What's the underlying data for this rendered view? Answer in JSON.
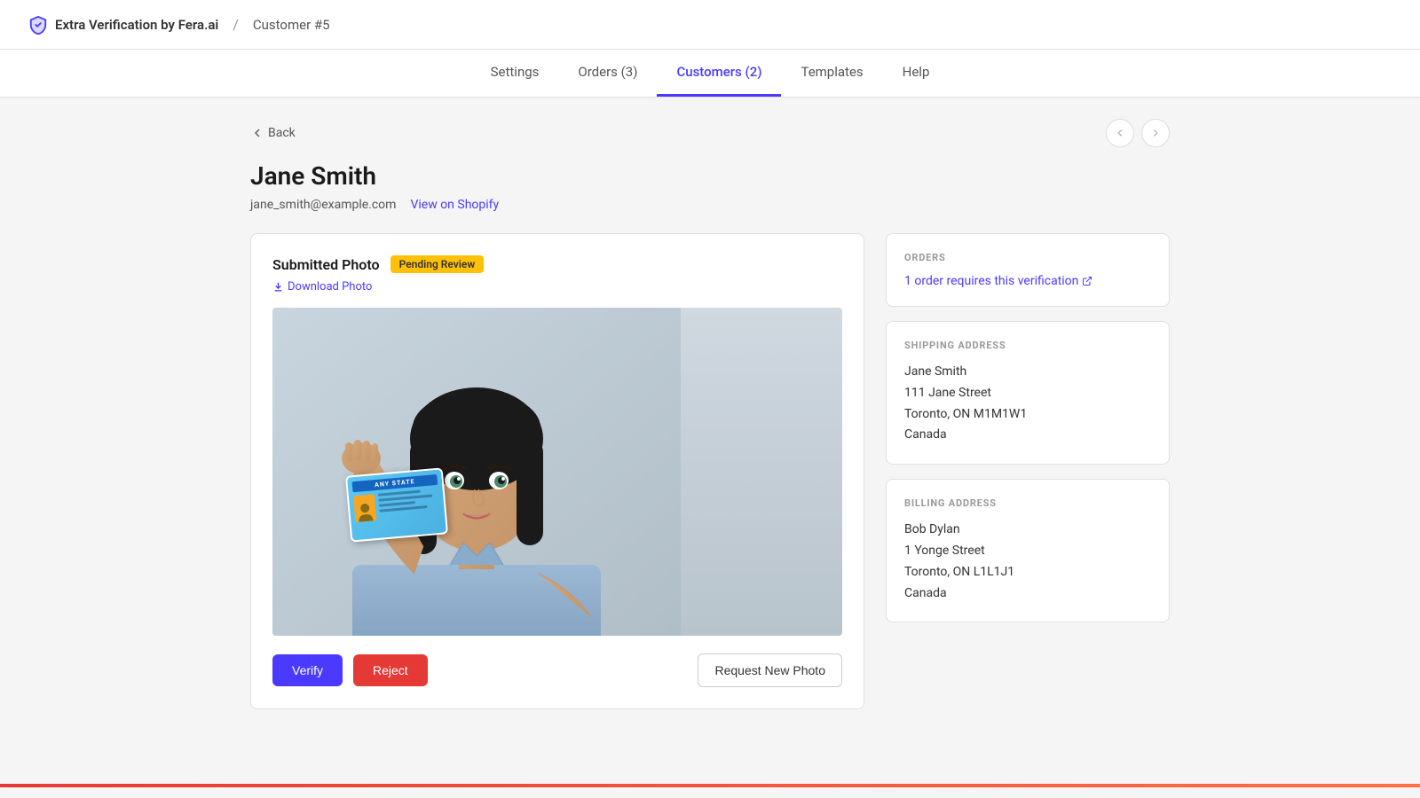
{
  "topbar": {
    "brand_name": "Extra Verification by Fera.ai",
    "separator": "/",
    "current_page": "Customer #5"
  },
  "nav": {
    "items": [
      {
        "id": "settings",
        "label": "Settings",
        "active": false,
        "count": null
      },
      {
        "id": "orders",
        "label": "Orders",
        "active": false,
        "count": "3"
      },
      {
        "id": "customers",
        "label": "Customers",
        "active": true,
        "count": "2"
      },
      {
        "id": "templates",
        "label": "Templates",
        "active": false,
        "count": null
      },
      {
        "id": "help",
        "label": "Help",
        "active": false,
        "count": null
      }
    ]
  },
  "back_link": "Back",
  "customer": {
    "name": "Jane Smith",
    "email": "jane_smith@example.com",
    "view_shopify_label": "View on Shopify"
  },
  "photo_section": {
    "title": "Submitted Photo",
    "badge": "Pending Review",
    "download_label": "Download Photo"
  },
  "action_buttons": {
    "verify": "Verify",
    "reject": "Reject",
    "request_new_photo": "Request New Photo"
  },
  "orders_section": {
    "title": "ORDERS",
    "link_text": "1 order requires this verification"
  },
  "shipping_address": {
    "title": "SHIPPING ADDRESS",
    "name": "Jane Smith",
    "street": "111 Jane Street",
    "city_province_postal": "Toronto, ON M1M1W1",
    "country": "Canada"
  },
  "billing_address": {
    "title": "BILLING ADDRESS",
    "name": "Bob Dylan",
    "street": "1 Yonge Street",
    "city_province_postal": "Toronto, ON L1L1J1",
    "country": "Canada"
  },
  "id_card": {
    "header": "ANY STATE"
  }
}
